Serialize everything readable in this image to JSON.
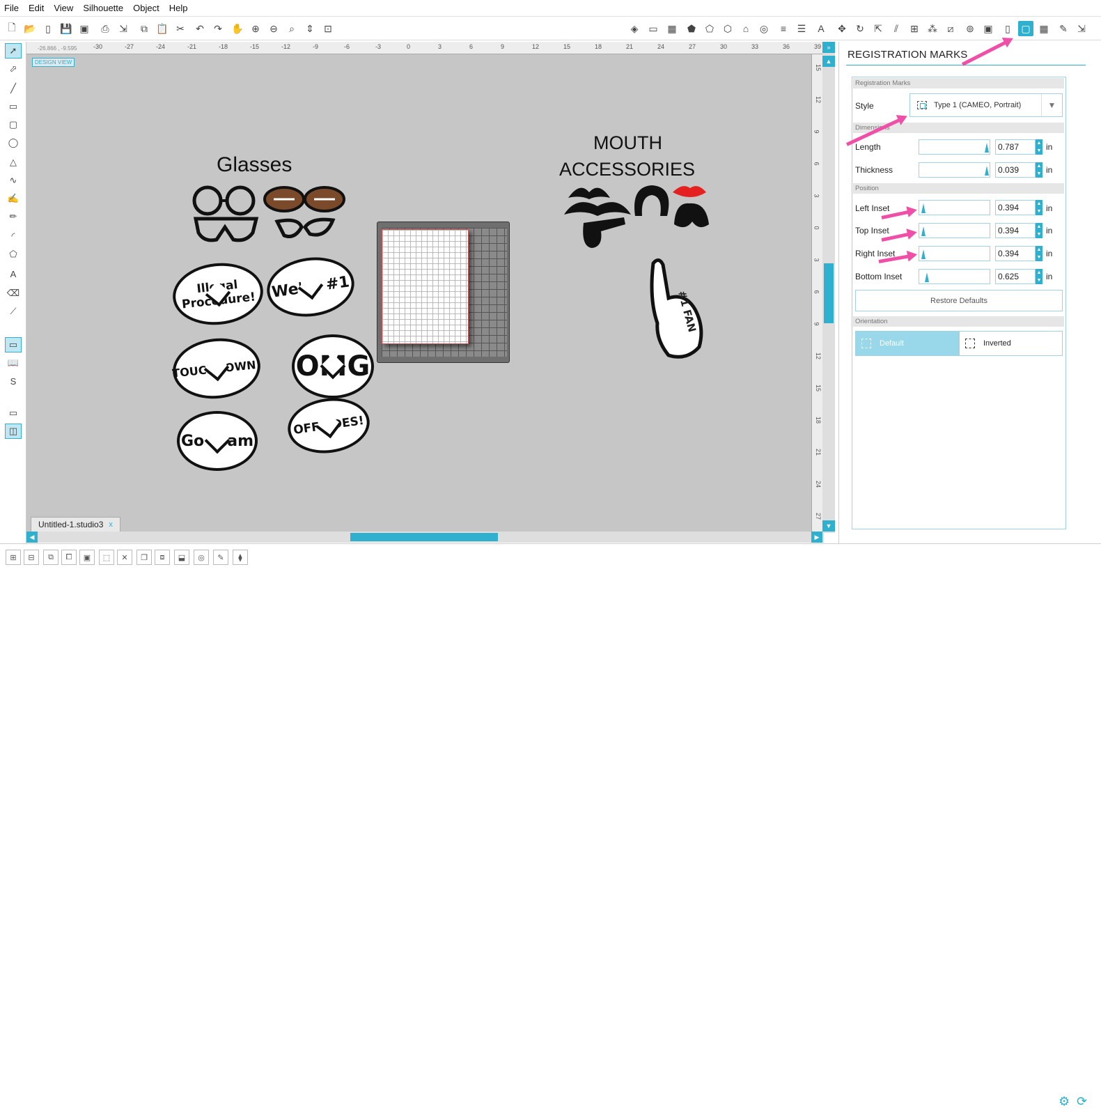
{
  "menu": [
    "File",
    "Edit",
    "View",
    "Silhouette",
    "Object",
    "Help"
  ],
  "ruler": {
    "coords": "-26.866 , -9.595",
    "h_ticks": [
      "-30",
      "-27",
      "-24",
      "-21",
      "-18",
      "-15",
      "-12",
      "-9",
      "-6",
      "-3",
      "0",
      "3",
      "6",
      "9",
      "12",
      "15",
      "18",
      "21",
      "24",
      "27",
      "30",
      "33",
      "36",
      "39"
    ],
    "v_ticks": [
      "15",
      "12",
      "9",
      "6",
      "3",
      "0",
      "3",
      "6",
      "9",
      "12",
      "15",
      "18",
      "21",
      "24",
      "27"
    ]
  },
  "canvas": {
    "design_view_label": "DESIGN VIEW",
    "art": {
      "glasses_title": "Glasses",
      "mouth_title_1": "MOUTH",
      "mouth_title_2": "ACCESSORIES",
      "bubbles": [
        "Illegal Procedure!",
        "We're #1",
        "TOUCHDOWN!",
        "OMG",
        "Go team",
        "OFFSIDES!"
      ],
      "foam_finger": "#1 FAN"
    }
  },
  "document_tab": {
    "name": "Untitled-1.studio3",
    "close": "x"
  },
  "panel": {
    "title": "REGISTRATION MARKS",
    "section_reg": "Registration Marks",
    "style_label": "Style",
    "style_value": "Type 1 (CAMEO, Portrait)",
    "section_dim": "Dimensions",
    "length_label": "Length",
    "length_value": "0.787",
    "thickness_label": "Thickness",
    "thickness_value": "0.039",
    "section_pos": "Position",
    "left_inset_label": "Left Inset",
    "left_inset_value": "0.394",
    "top_inset_label": "Top Inset",
    "top_inset_value": "0.394",
    "right_inset_label": "Right Inset",
    "right_inset_value": "0.394",
    "bottom_inset_label": "Bottom Inset",
    "bottom_inset_value": "0.625",
    "unit": "in",
    "restore_label": "Restore Defaults",
    "section_orient": "Orientation",
    "orient_default": "Default",
    "orient_inverted": "Inverted"
  },
  "colors": {
    "accent": "#2fb0cf",
    "annotation_arrow": "#ef4fa6",
    "canvas": "#c6c6c6"
  }
}
